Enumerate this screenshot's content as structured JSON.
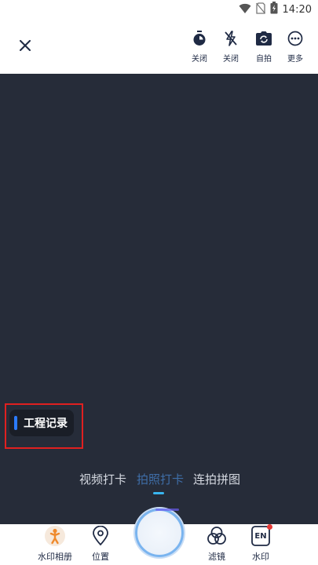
{
  "status_bar": {
    "time": "14:20",
    "icons": [
      "wifi-icon",
      "no-sim-icon",
      "battery-charging-icon"
    ]
  },
  "toolbar": {
    "close_icon": "close-icon",
    "tools": [
      {
        "icon": "timer-icon",
        "label": "关闭"
      },
      {
        "icon": "flash-off-icon",
        "label": "关闭"
      },
      {
        "icon": "camera-switch-icon",
        "label": "自拍"
      },
      {
        "icon": "more-icon",
        "label": "更多"
      }
    ]
  },
  "viewport": {
    "background_color": "#262c39",
    "watermark_card": {
      "label": "工程记录",
      "accent_color": "#2b7bff"
    },
    "highlight_color": "#e02020"
  },
  "modes": {
    "items": [
      "视频打卡",
      "拍照打卡",
      "连拍拼图"
    ],
    "selected": "拍照打卡",
    "indicator_color": "#39b6f0"
  },
  "bottom_bar": {
    "items": [
      {
        "icon": "watermark-album-icon",
        "label": "水印相册"
      },
      {
        "icon": "location-pin-icon",
        "label": "位置"
      },
      {
        "icon": "filter-icon",
        "label": "滤镜"
      },
      {
        "icon": "watermark-icon",
        "label": "水印"
      }
    ],
    "watermark_icon_text": "EN"
  }
}
